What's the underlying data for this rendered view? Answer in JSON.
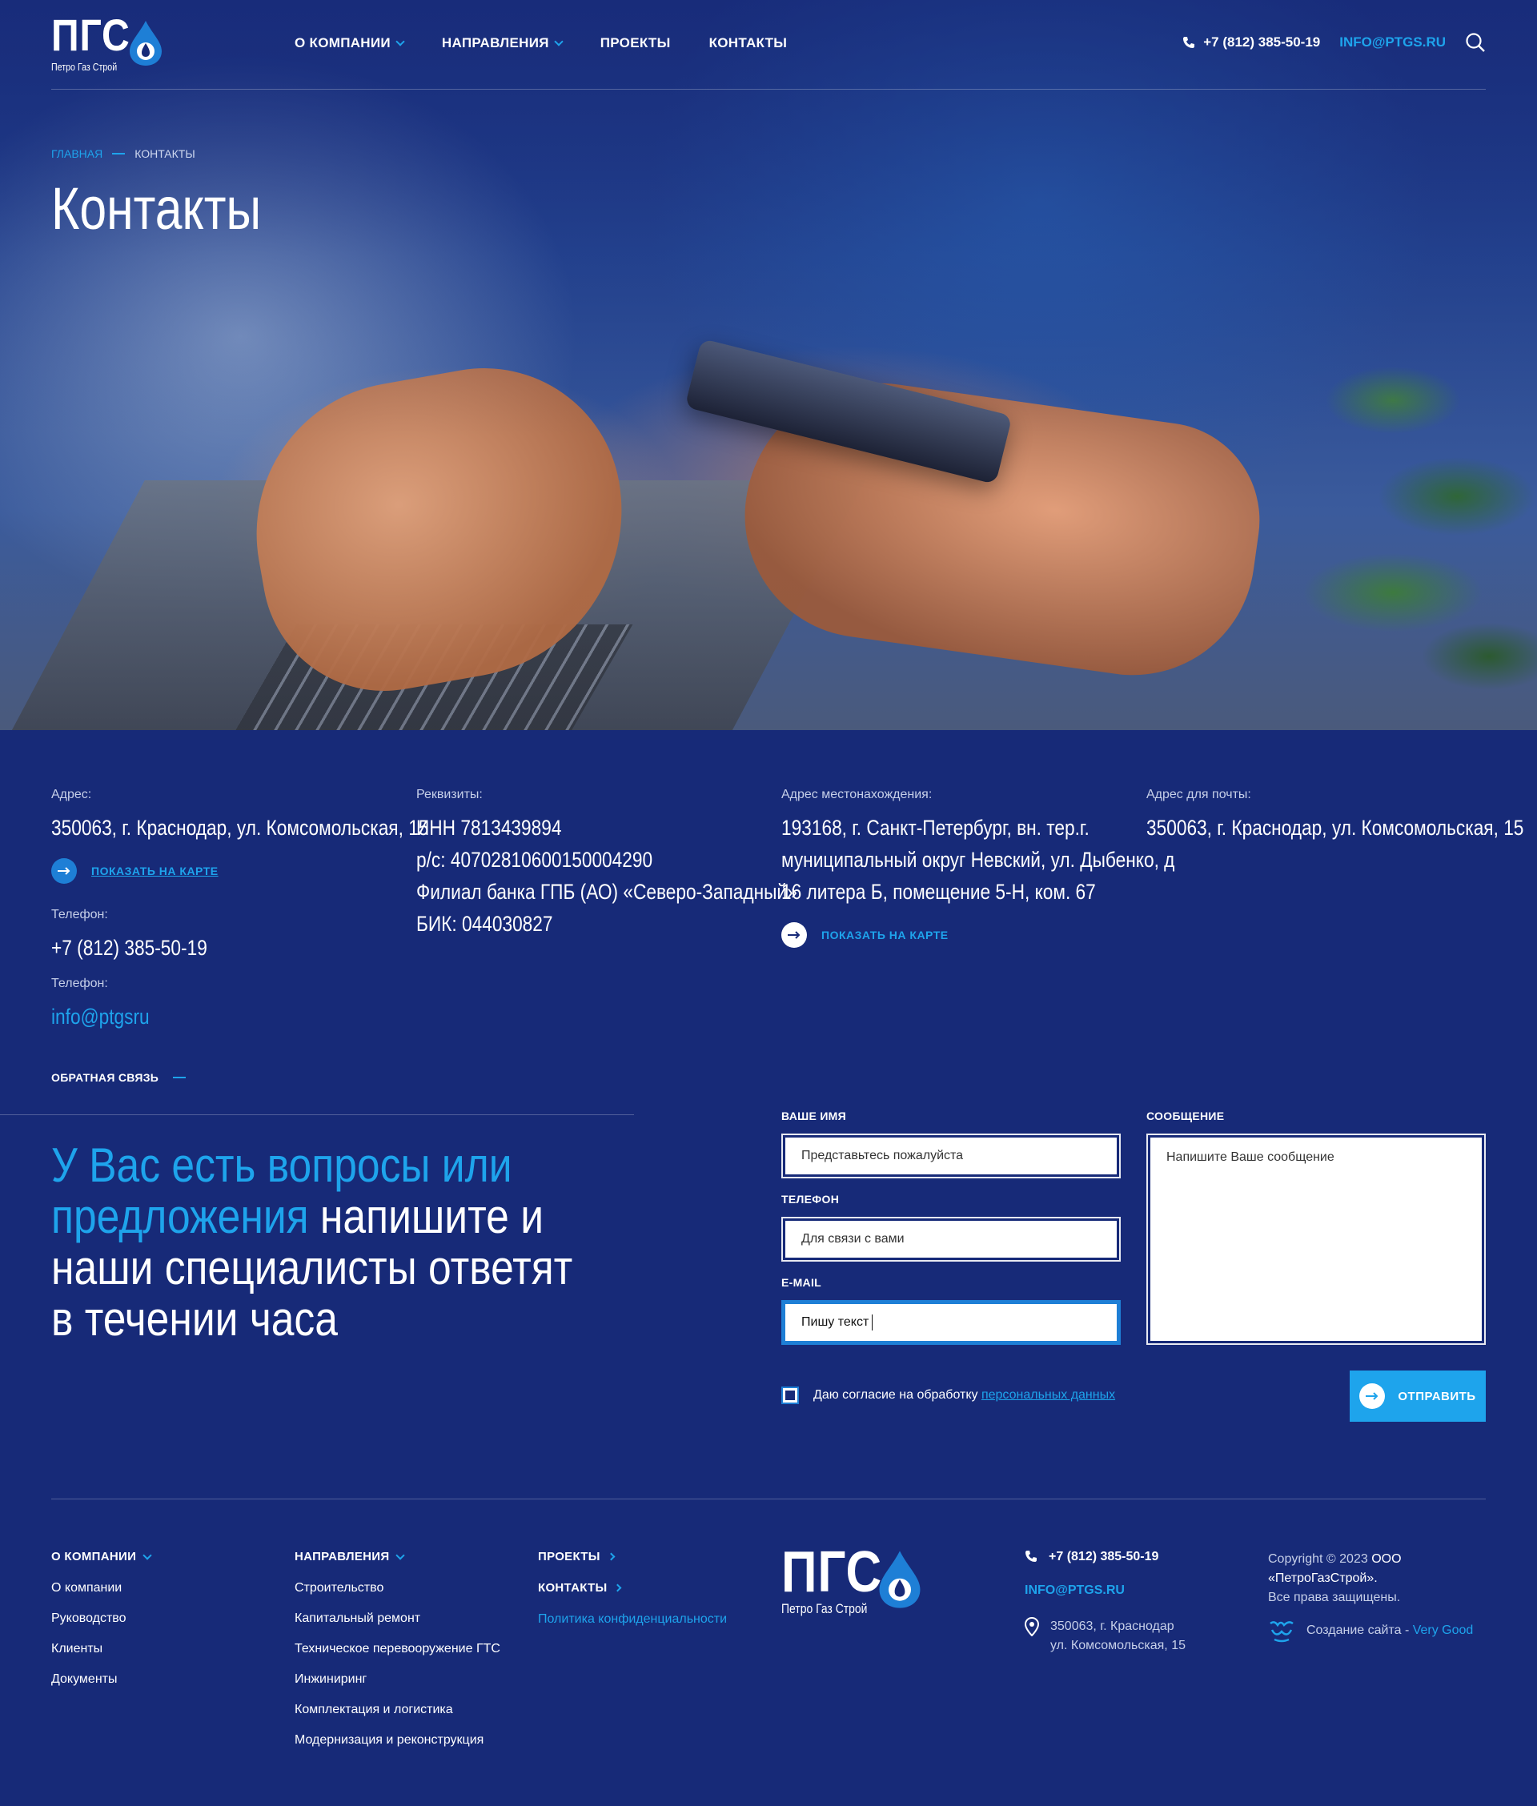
{
  "header": {
    "logo_text": "ПГС",
    "logo_sub": "Петро Газ Строй",
    "nav": [
      {
        "label": "О КОМПАНИИ",
        "dropdown": true
      },
      {
        "label": "НАПРАВЛЕНИЯ",
        "dropdown": true
      },
      {
        "label": "ПРОЕКТЫ",
        "dropdown": false
      },
      {
        "label": "КОНТАКТЫ",
        "dropdown": false
      }
    ],
    "phone": "+7 (812) 385-50-19",
    "email": "INFO@PTGS.RU"
  },
  "breadcrumb": {
    "home": "ГЛАВНАЯ",
    "current": "КОНТАКТЫ"
  },
  "page_title": "Контакты",
  "contacts": {
    "col1": {
      "address_label": "Адрес:",
      "address": "350063, г. Краснодар, ул. Комсомольская, 15",
      "map_link": "ПОКАЗАТЬ НА КАРТЕ",
      "phone_label": "Телефон:",
      "phone": "+7 (812) 385-50-19",
      "email_label": "Телефон:",
      "email": "info@ptgsru"
    },
    "col2": {
      "label": "Реквизиты:",
      "lines": [
        "ИНН 7813439894",
        "р/с: 40702810600150004290",
        "Филиал банка ГПБ (АО)  «Северо-Западный»",
        "БИК: 044030827"
      ]
    },
    "col3": {
      "label": "Адрес местонахождения:",
      "lines": [
        "193168, г. Санкт-Петербург, вн. тер.г.",
        "муниципальный округ Невский, ул. Дыбенко, д",
        "16 литера Б, помещение 5-Н, ком. 67"
      ],
      "map_link": "ПОКАЗАТЬ НА КАРТЕ"
    },
    "col4": {
      "label": "Адрес для почты:",
      "address": "350063, г. Краснодар, ул. Комсомольская, 15"
    }
  },
  "feedback": {
    "tag": "ОБРАТНАЯ СВЯЗЬ",
    "heading_highlight": "У Вас есть вопросы или предложения",
    "heading_rest": " напишите и наши специалисты ответят в течении часа",
    "name_label": "ВАШЕ ИМЯ",
    "name_placeholder": "Представьтесь пожалуйста",
    "phone_label": "ТЕЛЕФОН",
    "phone_placeholder": "Для связи с вами",
    "email_label": "E-MAIL",
    "email_value": "Пишу текст",
    "message_label": "СООБЩЕНИЕ",
    "message_placeholder": "Напишите Ваше сообщение",
    "consent_text": "Даю согласие на обработку",
    "consent_link": "персональных данных",
    "submit": "ОТПРАВИТЬ"
  },
  "footer": {
    "col_company": {
      "title": "О КОМПАНИИ",
      "items": [
        "О компании",
        "Руководство",
        "Клиенты",
        "Документы"
      ]
    },
    "col_directions": {
      "title": "НАПРАВЛЕНИЯ",
      "items": [
        "Строительство",
        "Капитальный ремонт",
        "Техническое перевооружение ГТС",
        "Инжиниринг",
        "Комплектация и логистика",
        "Модернизация и реконструкция"
      ]
    },
    "col_misc": {
      "projects": "ПРОЕКТЫ",
      "contacts": "КОНТАКТЫ",
      "privacy": "Политика конфиденциальности"
    },
    "logo_text": "ПГС",
    "logo_sub": "Петро Газ Строй",
    "phone": "+7 (812) 385-50-19",
    "email": "INFO@PTGS.RU",
    "address_line1": "350063, г. Краснодар",
    "address_line2": "ул. Комсомольская, 15",
    "copyright_prefix": "Copyright © 2023",
    "copyright_company": " ООО «ПетроГазСтрой».",
    "rights": "Все права защищены.",
    "made_by_prefix": "Создание сайта - ",
    "made_by": "Very Good"
  },
  "colors": {
    "bg": "#172a78",
    "accent": "#1ea4ec",
    "button": "#1ea4ec"
  }
}
